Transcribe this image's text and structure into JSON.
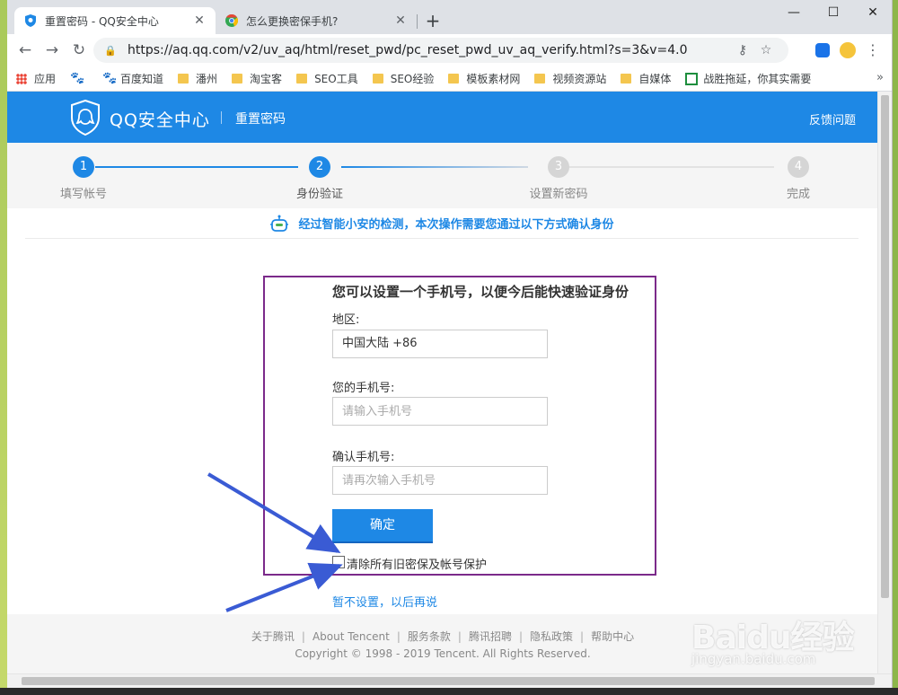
{
  "browser": {
    "tabs": [
      {
        "title": "重置密码 - QQ安全中心",
        "active": true
      },
      {
        "title": "怎么更换密保手机?",
        "active": false
      }
    ],
    "url": "https://aq.qq.com/v2/uv_aq/html/reset_pwd/pc_reset_pwd_uv_aq_verify.html?s=3&v=4.0",
    "window_buttons": {
      "minimize": "—",
      "maximize": "☐",
      "close": "✕"
    },
    "bookmarks": [
      {
        "label": "应用",
        "icon": "apps-grid-icon"
      },
      {
        "label": "",
        "icon": "baidu-paw-icon"
      },
      {
        "label": "百度知道",
        "icon": "baidu-paw-icon"
      },
      {
        "label": "潘州",
        "icon": "folder-icon"
      },
      {
        "label": "淘宝客",
        "icon": "folder-icon"
      },
      {
        "label": "SEO工具",
        "icon": "folder-icon"
      },
      {
        "label": "SEO经验",
        "icon": "folder-icon"
      },
      {
        "label": "模板素材网",
        "icon": "folder-icon"
      },
      {
        "label": "视频资源站",
        "icon": "folder-icon"
      },
      {
        "label": "自媒体",
        "icon": "folder-icon"
      },
      {
        "label": "战胜拖延，你其实需要",
        "icon": "green-square-icon"
      }
    ],
    "bookmarks_more": "»"
  },
  "header": {
    "brand": "QQ安全中心",
    "subtitle": "重置密码",
    "feedback": "反馈问题"
  },
  "steps": [
    {
      "num": "1",
      "label": "填写帐号",
      "state": "done"
    },
    {
      "num": "2",
      "label": "身份验证",
      "state": "current"
    },
    {
      "num": "3",
      "label": "设置新密码",
      "state": "pending"
    },
    {
      "num": "4",
      "label": "完成",
      "state": "pending"
    }
  ],
  "notice": "经过智能小安的检测，本次操作需要您通过以下方式确认身份",
  "form": {
    "title": "您可以设置一个手机号，以便今后能快速验证身份",
    "region_label": "地区:",
    "region_value": "中国大陆 +86",
    "phone_label": "您的手机号:",
    "phone_placeholder": "请输入手机号",
    "confirm_label": "确认手机号:",
    "confirm_placeholder": "请再次输入手机号",
    "submit": "确定",
    "clear_checkbox_label": "清除所有旧密保及帐号保护",
    "skip_link": "暂不设置，以后再说"
  },
  "footer": {
    "links": [
      "关于腾讯",
      "About Tencent",
      "服务条款",
      "腾讯招聘",
      "隐私政策",
      "帮助中心"
    ],
    "copyright": "Copyright © 1998 - 2019 Tencent. All Rights Reserved."
  },
  "watermark": {
    "main": "Baidu经验",
    "sub": "jingyan.baidu.com"
  },
  "colors": {
    "brand_blue": "#1e88e5",
    "highlight_border": "#7b2a8a",
    "annotation_arrow": "#3a5bd4"
  }
}
